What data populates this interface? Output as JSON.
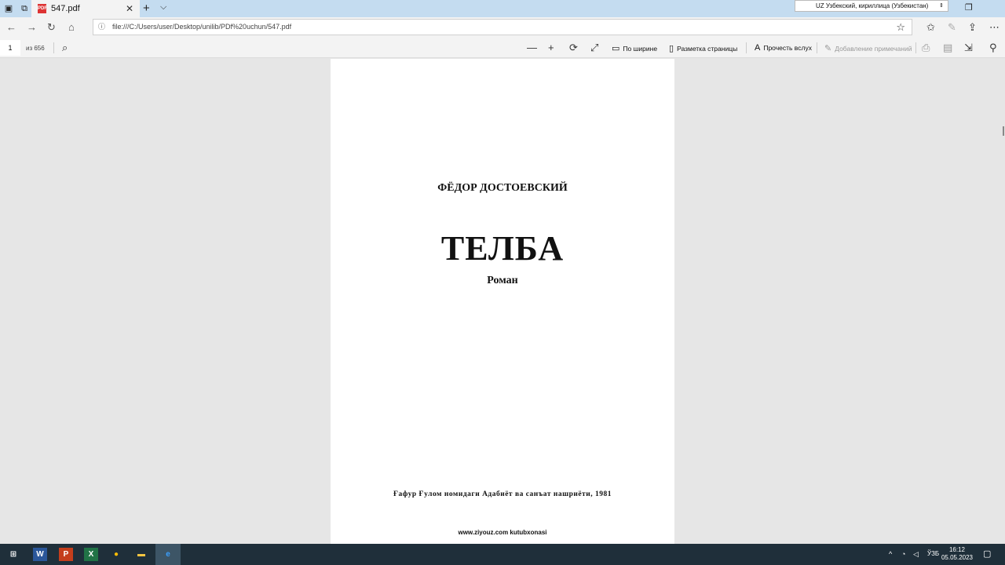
{
  "tab": {
    "title": "547.pdf",
    "close": "✕",
    "pdf_badge": "PDF"
  },
  "new_tab": "+",
  "tab_menu": "⌵",
  "language": {
    "label": "UZ Узбекский, кириллица (Узбекистан)"
  },
  "address": {
    "url": "file:///C:/Users/user/Desktop/unilib/PDf%20uchun/547.pdf"
  },
  "pdf_toolbar": {
    "page_current": "1",
    "page_total": "из 656",
    "fit_width": "По ширине",
    "page_layout": "Разметка страницы",
    "read_aloud": "Прочесть вслух",
    "add_notes": "Добавление примечаний"
  },
  "document": {
    "author": "ФЁДОР ДОСТОЕВСКИЙ",
    "title": "ТЕЛБА",
    "subtitle": "Роман",
    "publisher": "Ғафур Ғулом номидаги Адабиёт ва санъат нашриёти, 1981",
    "site": "www.ziyouz.com kutubxonasi"
  },
  "taskbar": {
    "apps": [
      "W",
      "P",
      "X",
      "●",
      "▬",
      "e"
    ],
    "lang": "ЎЗБ",
    "time": "16:12",
    "date": "05.05.2023"
  },
  "colors": {
    "titlebar": "#c4dcf0",
    "taskbar": "#1f2f3a",
    "toolbar": "#f3f3f3"
  }
}
